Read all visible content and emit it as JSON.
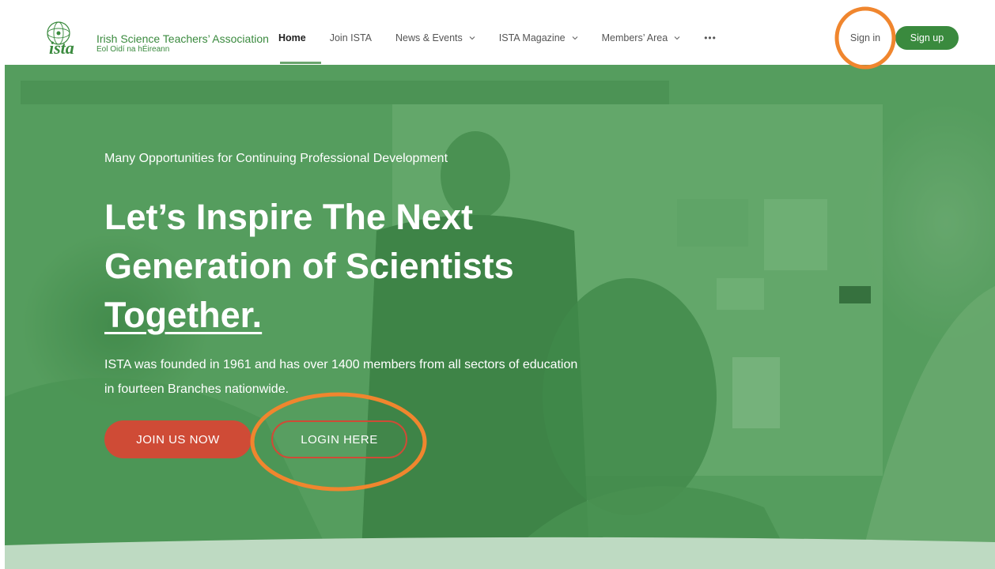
{
  "header": {
    "logo": {
      "mark_text": "ista",
      "name": "Irish Science Teachers’ Association",
      "subtitle": "Eol Oidí na hÉireann"
    },
    "nav": [
      {
        "label": "Home",
        "active": true
      },
      {
        "label": "Join ISTA",
        "active": false
      },
      {
        "label": "News & Events",
        "active": false,
        "dropdown": true
      },
      {
        "label": "ISTA Magazine",
        "active": false,
        "dropdown": true
      },
      {
        "label": "Members’ Area",
        "active": false,
        "dropdown": true
      }
    ],
    "more_label": "•••",
    "sign_in": "Sign in",
    "sign_up": "Sign up"
  },
  "hero": {
    "kicker": "Many Opportunities for Continuing Professional Development",
    "title_line1": "Let’s Inspire The Next",
    "title_line2": "Generation of Scientists",
    "title_line3": "Together.",
    "description": "ISTA was founded in 1961 and has over 1400 members from all sectors of education in fourteen Branches nationwide.",
    "join_button": "JOIN US NOW",
    "login_button": "LOGIN HERE"
  },
  "colors": {
    "brand_green": "#3a8a3e",
    "hero_green": "#4f9a58",
    "cta_red": "#cf4b36",
    "annotation_orange": "#f0862e"
  }
}
